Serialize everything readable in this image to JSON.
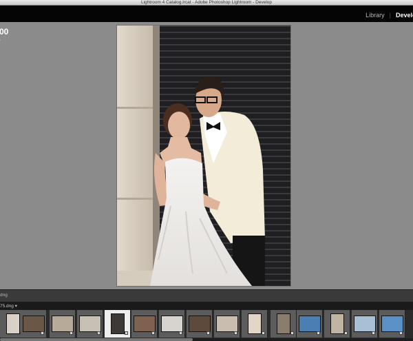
{
  "window": {
    "title": "Lightroom 4 Catalog.lrcat - Adobe Photoshop Lightroom - Develop"
  },
  "modules": {
    "library": "Library",
    "develop": "Develop"
  },
  "info": {
    "value": "00"
  },
  "infobar": {
    "text": "dng"
  },
  "filmstrip": {
    "filename": "75.dng ▾",
    "thumbs": [
      {
        "bg": "#d9d1c8",
        "cell": "sel"
      },
      {
        "bg": "#6b5745",
        "cell": "sel"
      },
      {
        "bg": "#b8aa99",
        "cell": "sel"
      },
      {
        "bg": "#c7c0b4",
        "cell": "sel"
      },
      {
        "bg": "#3d3934",
        "cell": "hi"
      },
      {
        "bg": "#7f6150",
        "cell": "sel"
      },
      {
        "bg": "#d7d3cf",
        "cell": "sel"
      },
      {
        "bg": "#5e4a3b",
        "cell": "sel"
      },
      {
        "bg": "#c9bdb0",
        "cell": "sel"
      },
      {
        "bg": "#e3d6c6",
        "cell": "sel"
      },
      {
        "bg": "#8a7d6d",
        "cell": "sel"
      },
      {
        "bg": "#4c7fb1",
        "cell": "sel"
      },
      {
        "bg": "#c2b4a3",
        "cell": "sel"
      },
      {
        "bg": "#a9bfd6",
        "cell": "sel"
      },
      {
        "bg": "#5a91c7",
        "cell": "sel"
      }
    ]
  }
}
